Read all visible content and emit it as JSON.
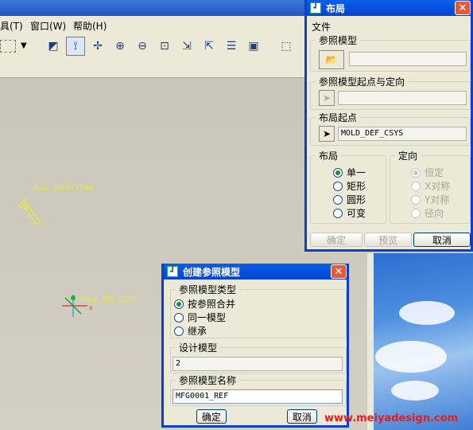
{
  "menubar": {
    "items": [
      "具(T)",
      "窗口(W)",
      "帮助(H)"
    ]
  },
  "canvas": {
    "pull_direction": "PULL DIRECTION",
    "csys_label": "MOLD_DEF_CSYS",
    "axis_x": "x"
  },
  "layout_dialog": {
    "title": "布局",
    "menu_file": "文件",
    "ref_model": {
      "label": "参照模型",
      "value": ""
    },
    "ref_origin": {
      "label": "参照模型起点与定向",
      "value": ""
    },
    "layout_origin": {
      "label": "布局起点",
      "value": "MOLD_DEF_CSYS"
    },
    "layout_group": {
      "label": "布局",
      "options": [
        "单一",
        "矩形",
        "圆形",
        "可变"
      ],
      "selected": 0
    },
    "orient_group": {
      "label": "定向",
      "options": [
        "恒定",
        "X对称",
        "Y对称",
        "径向"
      ],
      "selected": 0
    },
    "buttons": {
      "ok": "确定",
      "preview": "预览",
      "cancel": "取消"
    }
  },
  "create_dialog": {
    "title": "创建参照模型",
    "type": {
      "label": "参照模型类型",
      "options": [
        "按参照合并",
        "同一模型",
        "继承"
      ],
      "selected": 0
    },
    "design_model": {
      "label": "设计模型",
      "value": "2"
    },
    "ref_name": {
      "label": "参照模型名称",
      "value": "MFG0001_REF"
    },
    "buttons": {
      "ok": "确定",
      "cancel": "取消"
    }
  },
  "watermark": "www.meiyadesign.com",
  "colors": {
    "title_blue": "#0245d3",
    "canvas_yellow": "#e8e64a",
    "watermark_red": "#e02020"
  }
}
